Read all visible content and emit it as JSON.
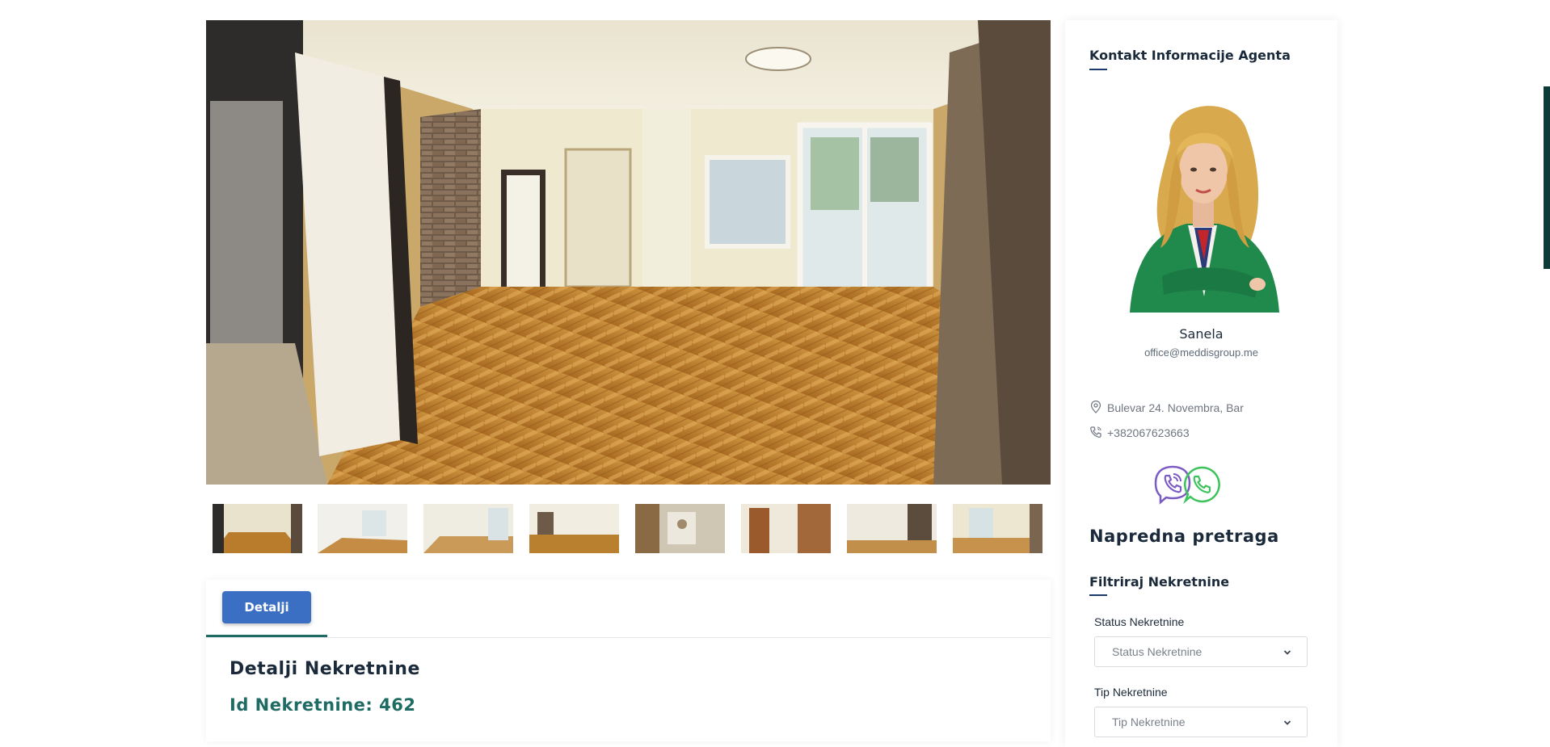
{
  "gallery": {
    "thumbnail_count": 8
  },
  "details": {
    "tab_label": "Detalji",
    "title": "Detalji Nekretnine",
    "id_text": "Id Nekretnine: 462"
  },
  "agent": {
    "section_title": "Kontakt Informacije Agenta",
    "name": "Sanela",
    "email": "office@meddisgroup.me",
    "address": "Bulevar 24. Novembra, Bar",
    "phone": "+382067623663",
    "icons": [
      "map-pin-icon",
      "phone-icon",
      "viber-icon",
      "whatsapp-icon"
    ]
  },
  "search": {
    "heading": "Napredna pretraga",
    "filter_title": "Filtriraj Nekretnine",
    "status_label": "Status Nekretnine",
    "status_placeholder": "Status Nekretnine",
    "type_label": "Tip Nekretnine",
    "type_placeholder": "Tip Nekretnine"
  },
  "colors": {
    "accent_green": "#1e6b63",
    "button_blue": "#3b6fc3",
    "viber_purple": "#7b5cc4",
    "whatsapp_green": "#3cc35c",
    "dark_text": "#1b2a3a"
  }
}
